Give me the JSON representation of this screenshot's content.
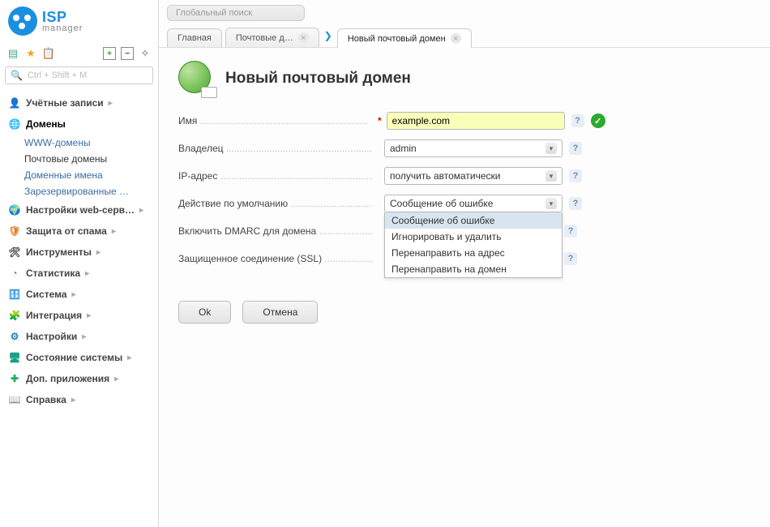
{
  "logo": {
    "line1": "ISP",
    "line2": "manager"
  },
  "toolbar": {
    "search_placeholder": "Ctrl + Shift + M"
  },
  "global_search_placeholder": "Глобальный поиск",
  "sidebar": {
    "items": [
      {
        "label": "Учётные записи"
      },
      {
        "label": "Домены",
        "sub": [
          {
            "label": "WWW-домены"
          },
          {
            "label": "Почтовые домены"
          },
          {
            "label": "Доменные имена"
          },
          {
            "label": "Зарезервированные …"
          }
        ]
      },
      {
        "label": "Настройки web-серв…"
      },
      {
        "label": "Защита от спама"
      },
      {
        "label": "Инструменты"
      },
      {
        "label": "Статистика"
      },
      {
        "label": "Система"
      },
      {
        "label": "Интеграция"
      },
      {
        "label": "Настройки"
      },
      {
        "label": "Состояние системы"
      },
      {
        "label": "Доп. приложения"
      },
      {
        "label": "Справка"
      }
    ]
  },
  "tabs": [
    {
      "label": "Главная"
    },
    {
      "label": "Почтовые д…"
    },
    {
      "label": "Новый почтовый домен"
    }
  ],
  "page": {
    "title": "Новый почтовый домен"
  },
  "form": {
    "name_label": "Имя",
    "name_value": "example.com",
    "owner_label": "Владелец",
    "owner_value": "admin",
    "ip_label": "IP-адрес",
    "ip_value": "получить автоматически",
    "action_label": "Действие по умолчанию",
    "action_value": "Сообщение об ошибке",
    "action_options": [
      "Сообщение об ошибке",
      "Игнорировать и удалить",
      "Перенаправить на адрес",
      "Перенаправить на домен"
    ],
    "dmarc_label": "Включить DMARC для домена",
    "ssl_label": "Защищенное соединение (SSL)"
  },
  "buttons": {
    "ok": "Ok",
    "cancel": "Отмена"
  },
  "dots": " .............................................................."
}
